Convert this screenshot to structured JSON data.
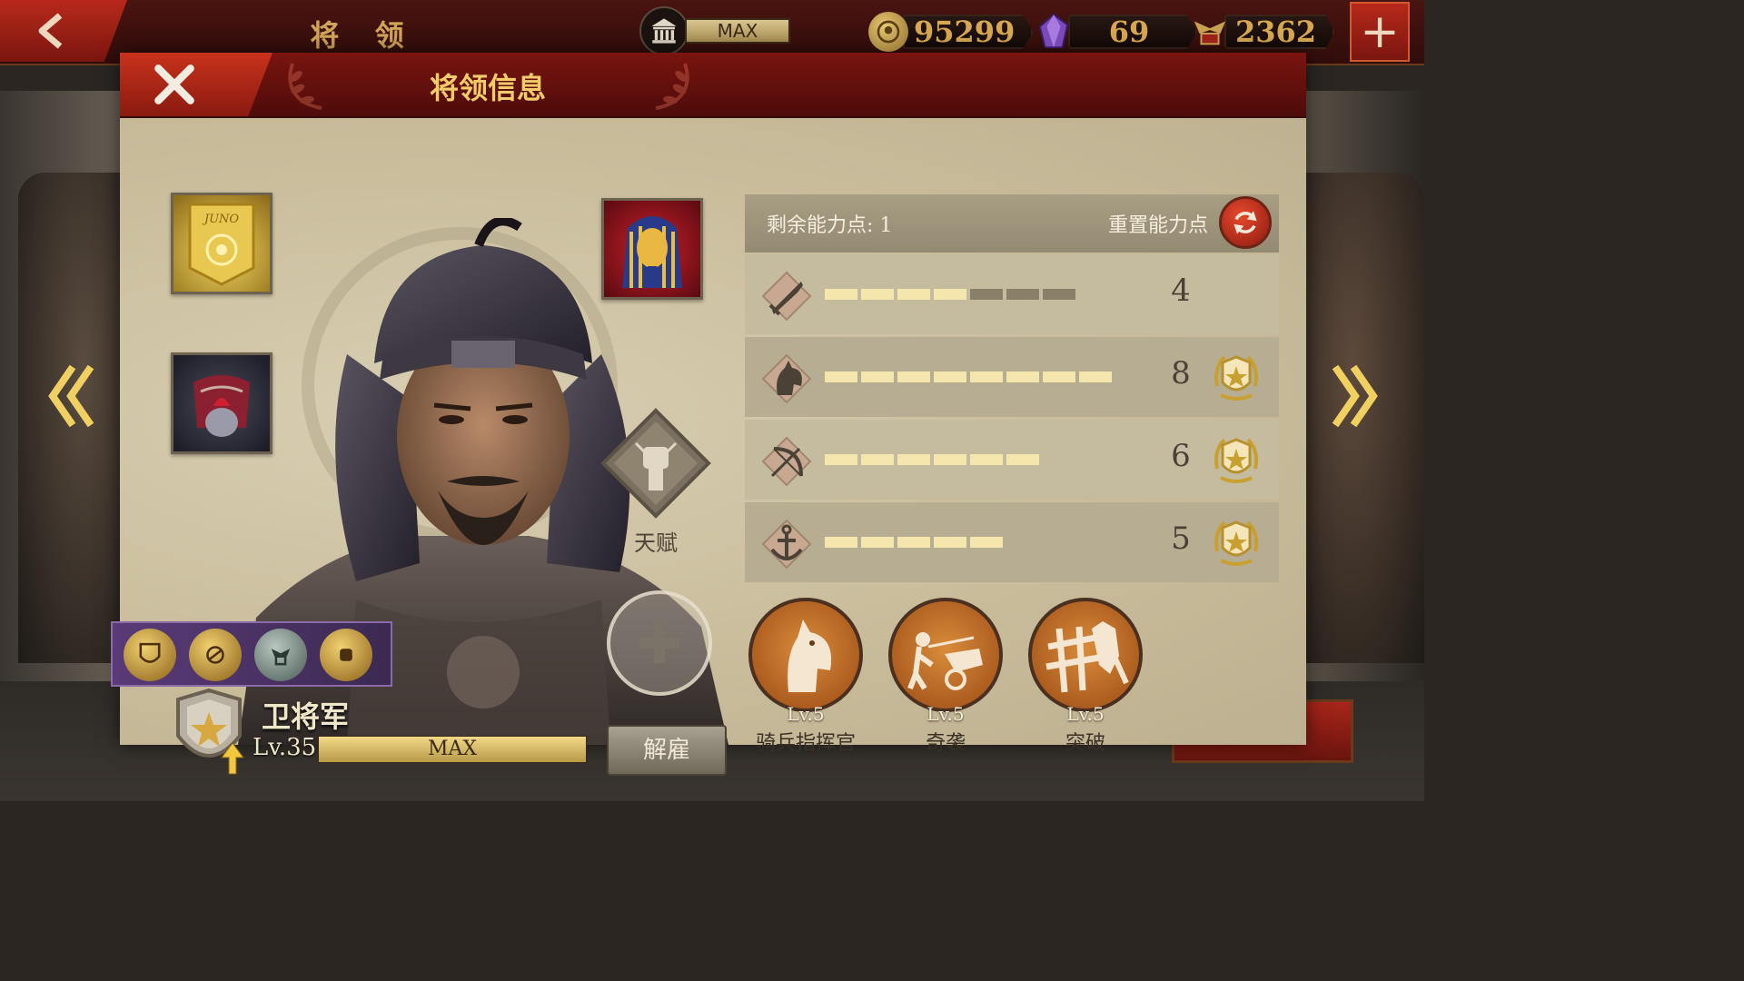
{
  "topbar": {
    "title": "将 领",
    "museum_label": "MAX",
    "gold": "95299",
    "gems": "69",
    "spqr_points": "2362"
  },
  "dialog": {
    "title": "将领信息",
    "points_remaining_label": "剩余能力点: 1",
    "reset_label": "重置能力点",
    "talent_label": "天赋",
    "hero": {
      "rank_name": "卫将军",
      "level": "Lv.35",
      "level_bar": "MAX",
      "level_progress": 1.0,
      "dismiss_label": "解雇"
    },
    "equipment": [
      {
        "slot": "banner",
        "text": "JUNO"
      },
      {
        "slot": "armor"
      },
      {
        "slot": "treasure"
      }
    ],
    "stats": [
      {
        "name": "attack",
        "icon": "sword-icon",
        "value": "4",
        "filled": 4,
        "max": 7,
        "badge": false
      },
      {
        "name": "cavalry",
        "icon": "horse-icon",
        "value": "8",
        "filled": 8,
        "max": 8,
        "badge": true
      },
      {
        "name": "archery",
        "icon": "bow-icon",
        "value": "6",
        "filled": 6,
        "max": 6,
        "badge": true
      },
      {
        "name": "navy",
        "icon": "anchor-icon",
        "value": "5",
        "filled": 5,
        "max": 5,
        "badge": true
      }
    ],
    "skills": [
      {
        "level": "Lv.5",
        "name": "骑兵指挥官",
        "icon": "horse-head-icon"
      },
      {
        "level": "Lv.5",
        "name": "奇袭",
        "icon": "chariot-icon"
      },
      {
        "level": "Lv.5",
        "name": "突破",
        "icon": "breakthrough-icon"
      }
    ]
  },
  "colors": {
    "header_red": "#7a1410",
    "gold_text": "#f2cc68",
    "panel_bg": "#cdc2a4",
    "bar_fill": "#f4e6ac",
    "bar_empty": "#8a7f68"
  }
}
